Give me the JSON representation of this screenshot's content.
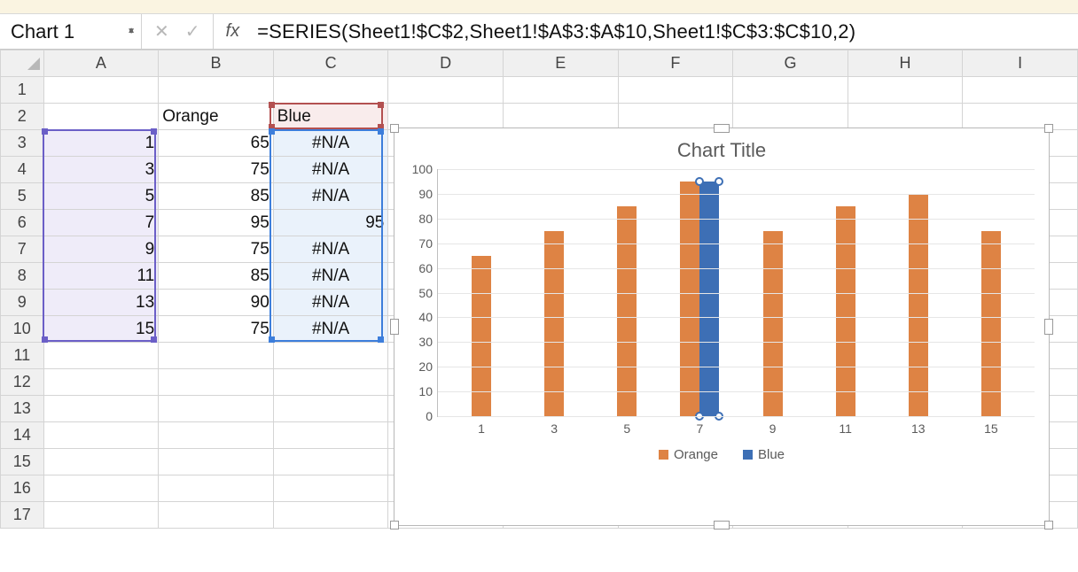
{
  "name_box": "Chart 1",
  "formula_bar": {
    "fx_label": "fx",
    "formula": "=SERIES(Sheet1!$C$2,Sheet1!$A$3:$A$10,Sheet1!$C$3:$C$10,2)"
  },
  "columns": [
    "A",
    "B",
    "C",
    "D",
    "E",
    "F",
    "G",
    "H",
    "I"
  ],
  "row_headers": [
    "1",
    "2",
    "3",
    "4",
    "5",
    "6",
    "7",
    "8",
    "9",
    "10",
    "11",
    "12",
    "13",
    "14",
    "15",
    "16",
    "17"
  ],
  "cells": {
    "B2": "Orange",
    "C2": "Blue",
    "A3": "1",
    "B3": "65",
    "C3": "#N/A",
    "A4": "3",
    "B4": "75",
    "C4": "#N/A",
    "A5": "5",
    "B5": "85",
    "C5": "#N/A",
    "A6": "7",
    "B6": "95",
    "C6": "95",
    "A7": "9",
    "B7": "75",
    "C7": "#N/A",
    "A8": "11",
    "B8": "85",
    "C8": "#N/A",
    "A9": "13",
    "B9": "90",
    "C9": "#N/A",
    "A10": "15",
    "B10": "75",
    "C10": "#N/A"
  },
  "chart_data": {
    "type": "bar",
    "title": "Chart Title",
    "xlabel": "",
    "ylabel": "",
    "ylim": [
      0,
      100
    ],
    "yticks": [
      0,
      10,
      20,
      30,
      40,
      50,
      60,
      70,
      80,
      90,
      100
    ],
    "categories": [
      "1",
      "3",
      "5",
      "7",
      "9",
      "11",
      "13",
      "15"
    ],
    "series": [
      {
        "name": "Orange",
        "values": [
          65,
          75,
          85,
          95,
          75,
          85,
          90,
          75
        ],
        "color": "#de8344"
      },
      {
        "name": "Blue",
        "values": [
          null,
          null,
          null,
          95,
          null,
          null,
          null,
          null
        ],
        "color": "#3d6fb5",
        "selected": true
      }
    ],
    "legend_position": "bottom"
  },
  "colors": {
    "purple": "#6b5fc7",
    "red": "#b35050",
    "blue": "#3d7edb",
    "orange_bar": "#de8344",
    "blue_bar": "#3d6fb5"
  }
}
